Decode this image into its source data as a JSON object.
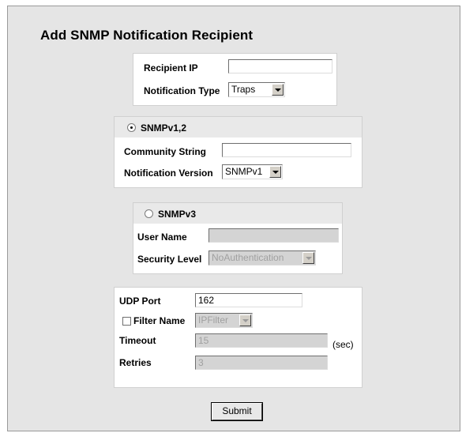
{
  "page": {
    "title": "Add SNMP Notification Recipient"
  },
  "recipient": {
    "ip_label": "Recipient IP",
    "ip_value": "",
    "type_label": "Notification Type",
    "type_value": "Traps"
  },
  "snmpv12": {
    "radio_label": "SNMPv1,2",
    "selected": true,
    "community_label": "Community String",
    "community_value": "",
    "version_label": "Notification Version",
    "version_value": "SNMPv1"
  },
  "snmpv3": {
    "radio_label": "SNMPv3",
    "selected": false,
    "username_label": "User Name",
    "username_value": "",
    "security_label": "Security Level",
    "security_value": "NoAuthentication"
  },
  "misc": {
    "udp_label": "UDP Port",
    "udp_value": "162",
    "filter_label": "Filter Name",
    "filter_checked": false,
    "filter_value": "IPFilter",
    "timeout_label": "Timeout",
    "timeout_value": "15",
    "timeout_unit": "(sec)",
    "retries_label": "Retries",
    "retries_value": "3"
  },
  "actions": {
    "submit_label": "Submit"
  }
}
